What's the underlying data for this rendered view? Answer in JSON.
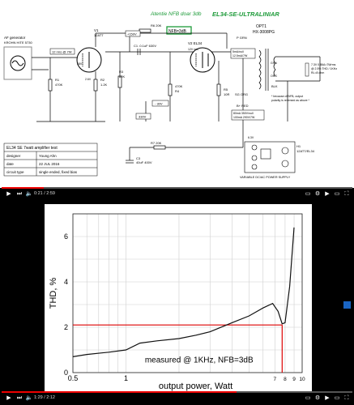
{
  "top_video": {
    "title": "EL34-SE-ULTRALINIAR",
    "annotation": "Atentie NFB doar 3db",
    "nfb_box": "NFB=3dB",
    "labels": {
      "af_gen": "AF generator",
      "af_gen2": "KROHN HITE 5730",
      "v1": "V1",
      "v1_type": "12AT7",
      "r6": "R6 20K",
      "plus_150v": "+150V",
      "c1": "C1 .0.1uF 630V",
      "v2": "V2 EL34",
      "r5": "R5",
      "r5v": "10R",
      "r1": "R1",
      "r1v": "470K",
      "r2": "R2",
      "r2v": "1.2K",
      "r3": "R3",
      "r3v": "82K",
      "r4": "R4",
      "r4v": "470K",
      "minus_30v": "- 30V",
      "plus_330v": "330V",
      "r7": "R7 20K",
      "c3": "C3",
      "c3v": "40uF 400V",
      "opt1": "OPT1",
      "opt1_type": "HX-3008PG",
      "p_grn": "P GRN",
      "sg_org": "SG ORG",
      "b_red": "B+ RED",
      "blk": "BLK",
      "grn": "GRN",
      "org": "ORG",
      "output_note": "7.3V 0.86A=7Wrms",
      "output_note2": "@ 2.5% THD / 1KHz",
      "output_note3": "RL=8 ohm",
      "nfb_note": "* because of NFB, output",
      "nfb_note2": "polarity is reversed as above *",
      "current_note": "80mA 350V/null",
      "current_note2": "100mA 290V/7W",
      "ma_note": "5mA/null",
      "ma_note2": "12.5mA/7W",
      "vin": "12 rms @ 7W",
      "v12": "12V rms",
      "v26": "2.6V",
      "v28": "28V",
      "power_supply": "VARIABLE DC/AC POWER SUPPLY",
      "h1": "H1",
      "h1v": "12AT7/EL34",
      "ps_out": "6.3V"
    },
    "table": {
      "title": "EL34 SE 7watt amplifier test",
      "rows": [
        [
          "designer",
          "Young Ahn"
        ],
        [
          "date",
          "22 JUL 2016"
        ],
        [
          "circuit type",
          "single ended, fixed bias"
        ]
      ]
    },
    "player": {
      "time": "0:21 / 2:59",
      "progress": 0.12
    }
  },
  "bottom_video": {
    "chart_data": {
      "type": "line",
      "title": "",
      "xlabel": "output power, Watt",
      "ylabel": "THD, %",
      "xscale": "log",
      "xlim": [
        0.5,
        10
      ],
      "ylim": [
        0,
        7
      ],
      "x_ticks": [
        0.5,
        1,
        7,
        8,
        9,
        10
      ],
      "x_tick_labels": [
        "0.5",
        "1",
        "7",
        "8",
        "9",
        "10"
      ],
      "y_ticks": [
        0,
        2,
        4,
        6
      ],
      "y_tick_labels": [
        "0",
        "2",
        "4",
        "6"
      ],
      "annotation": "measured @ 1KHz, NFB=3dB",
      "series": [
        {
          "name": "",
          "x": [
            0.5,
            0.6,
            0.8,
            1.0,
            1.2,
            1.5,
            2.0,
            2.5,
            3.0,
            4.0,
            5.0,
            6.0,
            6.8,
            7.3,
            7.7,
            8.0,
            8.5,
            9.0
          ],
          "y": [
            0.7,
            0.8,
            0.9,
            1.0,
            1.3,
            1.4,
            1.5,
            1.65,
            1.8,
            2.2,
            2.5,
            2.85,
            3.05,
            2.7,
            2.15,
            2.2,
            3.8,
            6.4
          ]
        }
      ],
      "reference_lines": [
        {
          "axis": "y",
          "value": 2.1
        },
        {
          "axis": "x",
          "value": 7.7
        }
      ]
    },
    "player": {
      "time": "1:29 / 2:12",
      "progress": 0.67
    }
  }
}
